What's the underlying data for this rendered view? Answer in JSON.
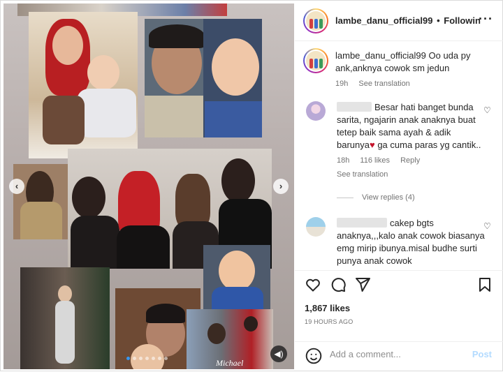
{
  "post": {
    "username": "lambe_danu_official99",
    "separator": "•",
    "follow_label": "Followin",
    "more_icon": "more-horizontal-icon",
    "media": {
      "watermark": "Michael",
      "dots_count": 7,
      "active_dot": 0
    }
  },
  "caption": {
    "username": "lambe_danu_official99",
    "text": "Oo uda py ank,anknya cowok sm jedun",
    "time": "19h",
    "see_translation": "See translation"
  },
  "comments": [
    {
      "text": "Besar hati banget bunda sarita, ngajarin anak anaknya buat tetep baik sama ayah & adik barunya",
      "emoji": "♥",
      "text_after": " ga cuma paras yg cantik..",
      "time": "18h",
      "likes": "116 likes",
      "reply": "Reply",
      "see_translation": "See translation",
      "view_replies": "View replies (4)"
    },
    {
      "text": "cakep bgts anaknya,,,kalo anak cowok biasanya emg mirip ibunya.misal budhe surti punya anak cowok"
    }
  ],
  "actions": {
    "likes": "1,867 likes",
    "time": "19 HOURS AGO"
  },
  "add_comment": {
    "placeholder": "Add a comment...",
    "post_label": "Post"
  },
  "colors": {
    "accent": "#3797f0",
    "post_disabled": "#b3dbff",
    "heart_red": "#ed4956",
    "muted": "#737373"
  }
}
